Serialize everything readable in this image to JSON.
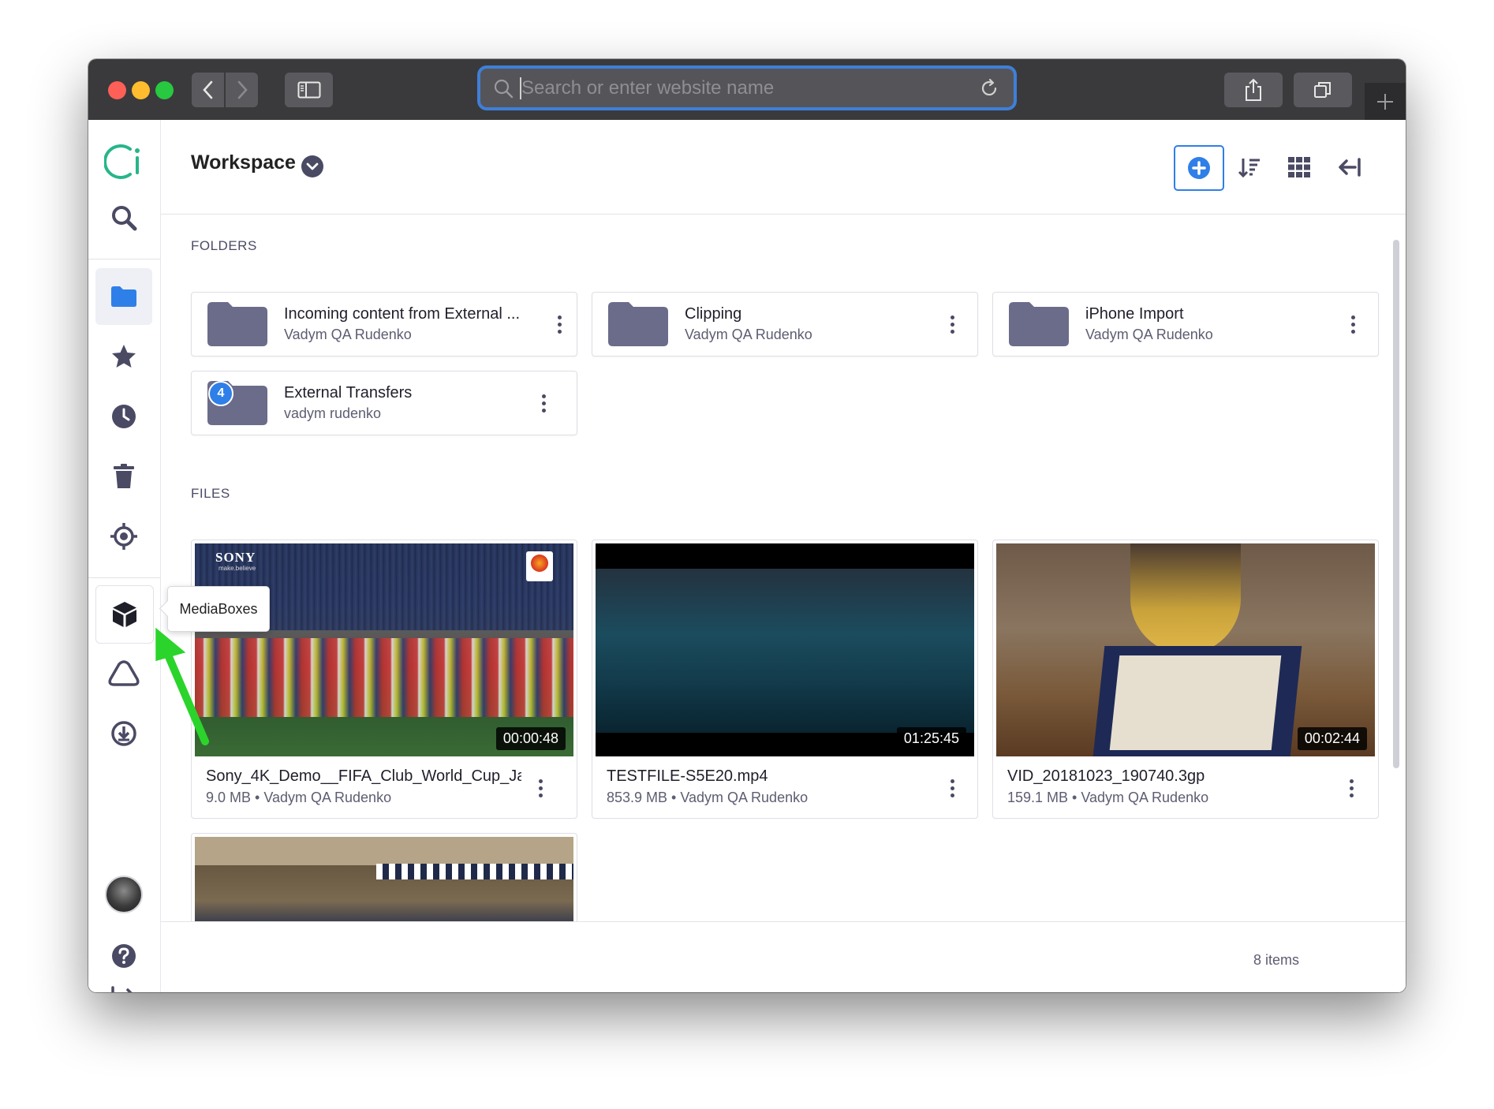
{
  "browser": {
    "url_placeholder": "Search or enter website name"
  },
  "header": {
    "title": "Workspace"
  },
  "sections": {
    "folders_label": "FOLDERS",
    "files_label": "FILES"
  },
  "folders": [
    {
      "name": "Incoming content from External ...",
      "owner": "Vadym QA Rudenko"
    },
    {
      "name": "Clipping",
      "owner": "Vadym QA Rudenko"
    },
    {
      "name": "iPhone Import",
      "owner": "Vadym QA Rudenko"
    },
    {
      "name": "External Transfers",
      "owner": "vadym rudenko"
    }
  ],
  "files": [
    {
      "name": "Sony_4K_Demo__FIFA_Club_World_Cup_Ja...",
      "meta": "9.0 MB • Vadym QA Rudenko",
      "duration": "00:00:48",
      "thumb_text": "SONY",
      "thumb_subtext": "make.believe"
    },
    {
      "name": "TESTFILE-S5E20.mp4",
      "meta": "853.9 MB • Vadym QA Rudenko",
      "duration": "01:25:45"
    },
    {
      "name": "VID_20181023_190740.3gp",
      "meta": "159.1 MB • Vadym QA Rudenko",
      "duration": "00:02:44"
    }
  ],
  "sidebar": {
    "recent_badge": "4",
    "tooltip": "MediaBoxes",
    "items": [
      "logo-icon",
      "search-icon",
      "folder-icon",
      "star-icon",
      "clock-icon",
      "trash-icon",
      "target-icon",
      "cube-icon",
      "triangle-icon",
      "download-icon",
      "avatar",
      "help-icon",
      "logout-icon"
    ]
  },
  "footer": {
    "items_count": "8 items"
  },
  "colors": {
    "accent": "#2f7fe8",
    "sidebar_active_bg": "#eef0f5",
    "folder": "#6b6b8a",
    "arrow": "#2bd42b",
    "titlebar": "#3a3a3c"
  }
}
